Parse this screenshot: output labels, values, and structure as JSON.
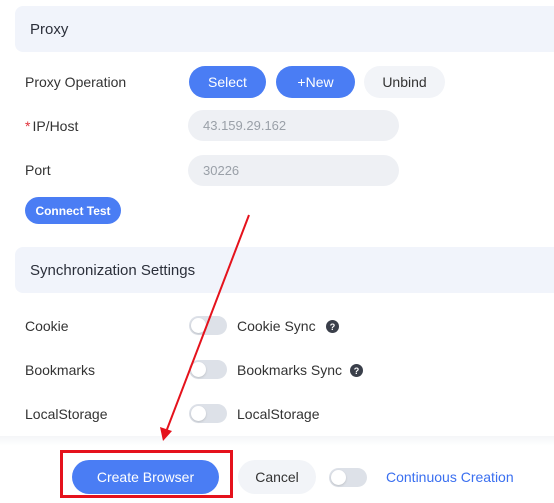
{
  "proxy": {
    "title": "Proxy",
    "operation_label": "Proxy Operation",
    "select_label": "Select",
    "new_label": "+New",
    "unbind_label": "Unbind",
    "ip_required_mark": "*",
    "ip_label": "IP/Host",
    "ip_value": "43.159.29.162",
    "port_label": "Port",
    "port_value": "30226",
    "connect_test_label": "Connect Test"
  },
  "sync": {
    "title": "Synchronization Settings",
    "rows": [
      {
        "label": "Cookie",
        "toggle_text": "Cookie Sync",
        "has_help": true,
        "on": false
      },
      {
        "label": "Bookmarks",
        "toggle_text": "Bookmarks Sync",
        "has_help": true,
        "on": false
      },
      {
        "label": "LocalStorage",
        "toggle_text": "LocalStorage",
        "has_help": false,
        "on": false
      }
    ]
  },
  "footer": {
    "create_label": "Create Browser",
    "cancel_label": "Cancel",
    "continuous_label": "Continuous Creation",
    "continuous_on": false
  },
  "colors": {
    "accent": "#4a7df4",
    "annotation": "#e5121c",
    "link": "#3a6ff0"
  },
  "icons": {
    "help": "question-circle-icon",
    "arrow": "red-annotation-arrow"
  }
}
